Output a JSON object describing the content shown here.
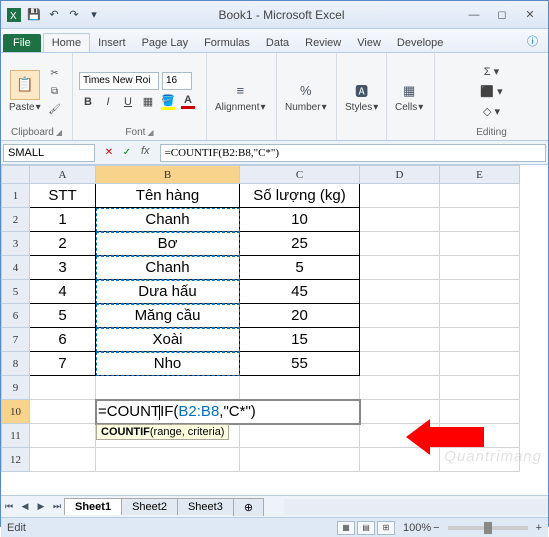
{
  "title": "Book1 - Microsoft Excel",
  "tabs": {
    "file": "File",
    "home": "Home",
    "insert": "Insert",
    "pagelayout": "Page Lay",
    "formulas": "Formulas",
    "data": "Data",
    "review": "Review",
    "view": "View",
    "developer": "Develope"
  },
  "ribbon": {
    "clipboard": {
      "label": "Clipboard",
      "paste": "Paste"
    },
    "font": {
      "label": "Font",
      "name": "Times New Roi",
      "size": "16"
    },
    "alignment": {
      "label": "Alignment"
    },
    "number": {
      "label": "Number"
    },
    "styles": {
      "label": "Styles"
    },
    "cells": {
      "label": "Cells"
    },
    "editing": {
      "label": "Editing"
    }
  },
  "namebox": "SMALL",
  "formula_bar": "=COUNTIF(B2:B8,\"C*\")",
  "columns": [
    "A",
    "B",
    "C",
    "D",
    "E"
  ],
  "headers": {
    "stt": "STT",
    "ten": "Tên hàng",
    "sl": "Số lượng (kg)"
  },
  "rows": [
    {
      "stt": "1",
      "ten": "Chanh",
      "sl": "10"
    },
    {
      "stt": "2",
      "ten": "Bơ",
      "sl": "25"
    },
    {
      "stt": "3",
      "ten": "Chanh",
      "sl": "5"
    },
    {
      "stt": "4",
      "ten": "Dưa hấu",
      "sl": "45"
    },
    {
      "stt": "5",
      "ten": "Măng cầu",
      "sl": "20"
    },
    {
      "stt": "6",
      "ten": "Xoài",
      "sl": "15"
    },
    {
      "stt": "7",
      "ten": "Nho",
      "sl": "55"
    }
  ],
  "cell_formula": {
    "pre": "=COUNT",
    "mid": "IF(",
    "range": "B2:B8",
    "post": ",\"C*\")"
  },
  "tooltip": {
    "fn": "COUNTIF",
    "args": "(range, criteria)"
  },
  "sheets": [
    "Sheet1",
    "Sheet2",
    "Sheet3"
  ],
  "status": "Edit",
  "zoom": "100%",
  "watermark": "Quantrimang"
}
